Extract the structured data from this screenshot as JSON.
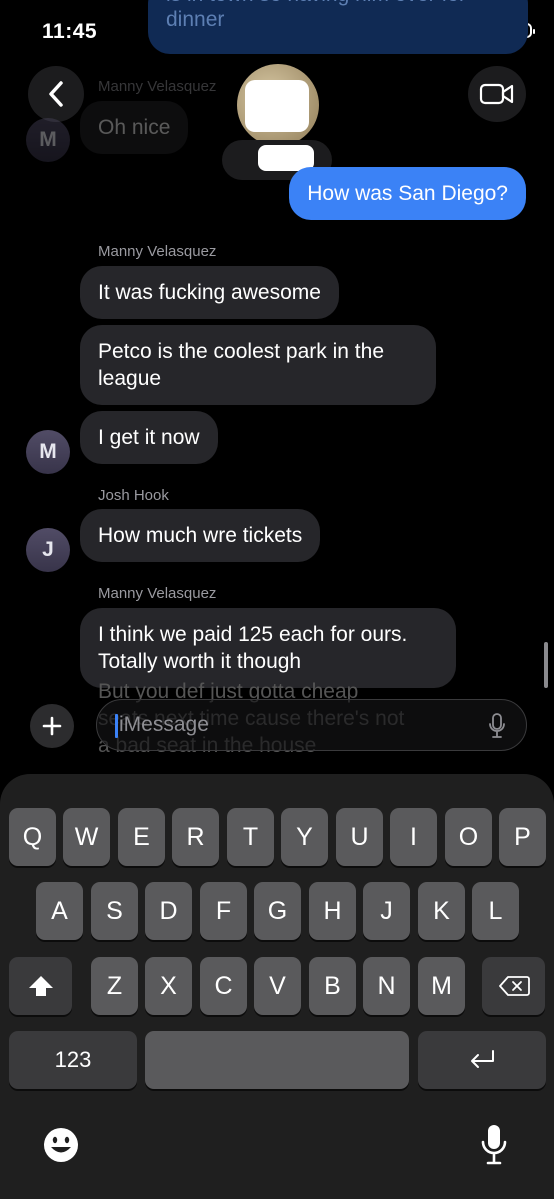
{
  "status": {
    "time": "11:45"
  },
  "thread": {
    "earlier_outgoing": "is in town so having him over for dinner",
    "earlier_sender": "Manny Velasquez",
    "earlier_incoming": "Oh nice",
    "outgoing_message": "How was San Diego?",
    "groups": [
      {
        "sender": "Manny Velasquez",
        "avatar_initial": "M",
        "messages": [
          "It was fucking awesome",
          "Petco is the coolest park in the league",
          "I get it now"
        ]
      },
      {
        "sender": "Josh Hook",
        "avatar_initial": "J",
        "messages": [
          "How much wre tickets"
        ]
      },
      {
        "sender": "Manny Velasquez",
        "messages": [
          "I think we paid 125 each for ours. Totally worth it though"
        ]
      }
    ],
    "partially_hidden": "But you def just gotta cheap seats next time cause there's not a bad seat in the house"
  },
  "compose": {
    "placeholder": "iMessage"
  },
  "keyboard": {
    "row1": [
      "Q",
      "W",
      "E",
      "R",
      "T",
      "Y",
      "U",
      "I",
      "O",
      "P"
    ],
    "row2": [
      "A",
      "S",
      "D",
      "F",
      "G",
      "H",
      "J",
      "K",
      "L"
    ],
    "row3": [
      "Z",
      "X",
      "C",
      "V",
      "B",
      "N",
      "M"
    ],
    "numbers_key": "123"
  },
  "colors": {
    "outgoing_bubble": "#3b82f6",
    "incoming_bubble": "#26262a",
    "background": "#000000"
  }
}
